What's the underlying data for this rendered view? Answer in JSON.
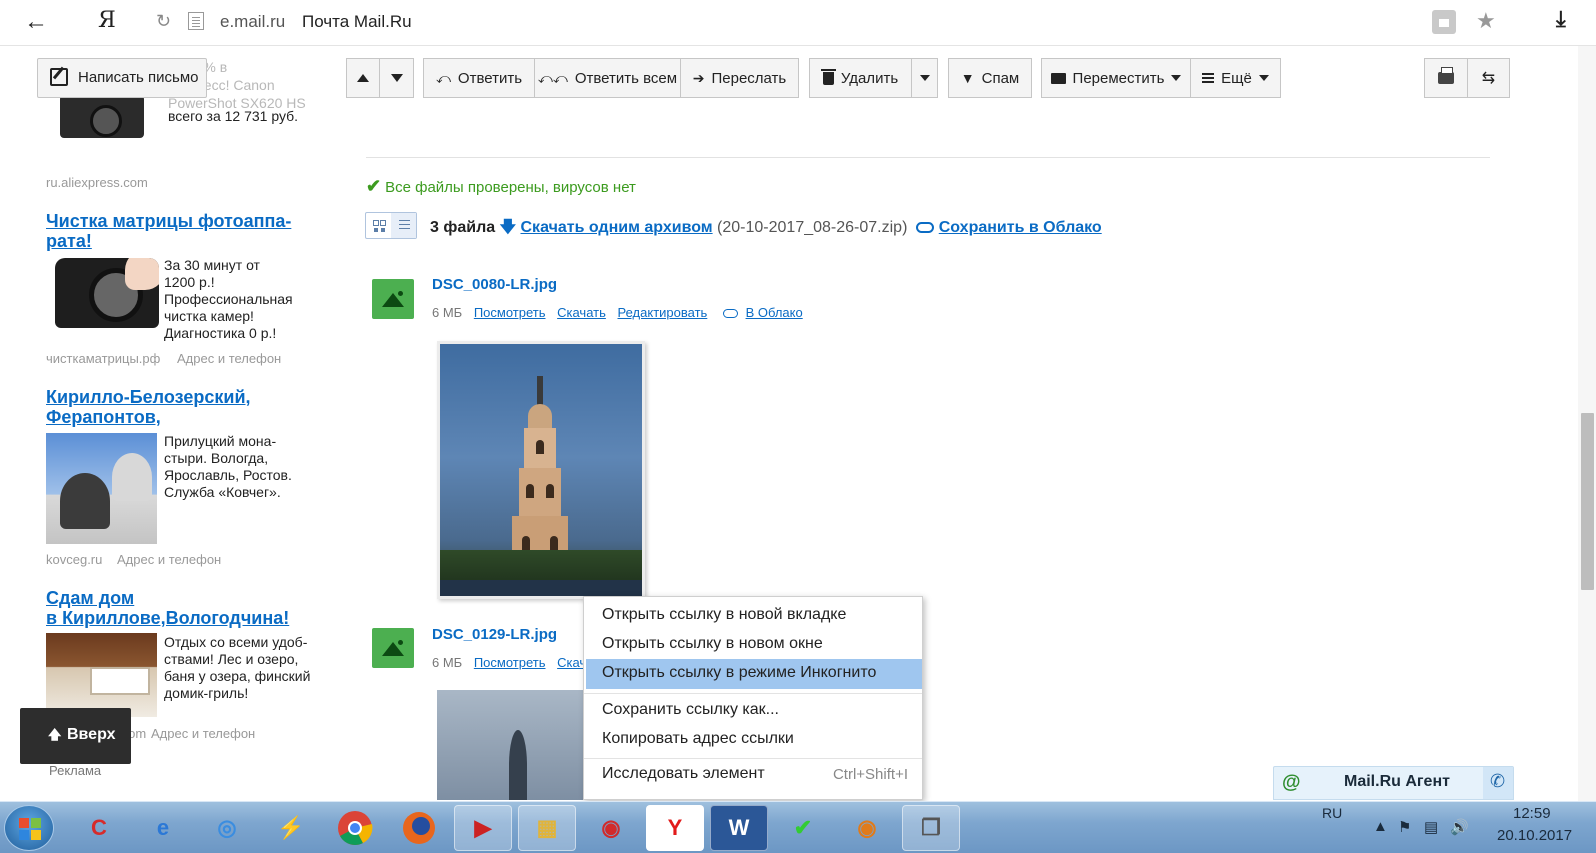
{
  "browser": {
    "domain": "e.mail.ru",
    "title": "Почта Mail.Ru",
    "yandex_glyph": "Я"
  },
  "left": {
    "compose_label": "Написать письмо",
    "ad_top_lines": [
      "до 50% в",
      "экспресс! Canon",
      "PowerShot SX620 HS"
    ],
    "ad_top_price": "всего за 12 731 руб.",
    "ad_top_domain": "ru.aliexpress.com",
    "ads": [
      {
        "title": [
          "Чистка матрицы фотоаппа-",
          "рата!"
        ],
        "desc": [
          "За 30 минут от",
          "1200 р.!",
          "Профессиональная",
          "чистка камер!",
          "Диагностика 0 р.!"
        ],
        "domain": "чисткаматрицы.рф",
        "contact": "Адрес и телефон"
      },
      {
        "title": [
          "Кирилло-Белозерский,",
          "Ферапонтов,"
        ],
        "desc": [
          "Прилуцкий мона-",
          "стыри. Вологда,",
          "Ярославль, Ростов.",
          "Служба «Ковчег»."
        ],
        "domain": "kovceg.ru",
        "contact": "Адрес и телефон"
      },
      {
        "title": [
          "Сдам дом",
          "в Кириллове,Вологодчина!"
        ],
        "desc": [
          "Отдых со всеми удоб-",
          "ствами! Лес и озеро,",
          "баня у озера, финский",
          "домик-гриль!"
        ],
        "domain": ".com",
        "contact": "Адрес и телефон"
      }
    ],
    "ads_label": "Реклама",
    "up_label": "Вверх"
  },
  "toolbar": {
    "reply": "Ответить",
    "reply_all": "Ответить всем",
    "forward": "Переслать",
    "delete": "Удалить",
    "spam": "Спам",
    "move": "Переместить",
    "more": "Ещё"
  },
  "attachments": {
    "virus_status": "Все файлы проверены, вирусов нет",
    "count": "3 файла",
    "download_all": "Скачать одним архивом",
    "archive_name": "(20-10-2017_08-26-07.zip)",
    "save_cloud": "Сохранить в Облако",
    "files": [
      {
        "name": "DSC_0080-LR.jpg",
        "size": "6 МБ",
        "view": "Посмотреть",
        "download": "Скачать",
        "edit": "Редактировать",
        "to_cloud": "В Облако"
      },
      {
        "name": "DSC_0129-LR.jpg",
        "size": "6 МБ",
        "view": "Посмотреть",
        "download": "Скач"
      }
    ]
  },
  "context_menu": {
    "items": [
      "Открыть ссылку в новой вкладке",
      "Открыть ссылку в новом окне",
      "Открыть ссылку в режиме Инкогнито",
      "Сохранить ссылку как...",
      "Копировать адрес ссылки",
      "Исследовать элемент"
    ],
    "inspect_shortcut": "Ctrl+Shift+I",
    "highlighted_index": 2
  },
  "agent": {
    "label": "Mail.Ru Агент",
    "at_glyph": "@"
  },
  "taskbar": {
    "lang": "RU",
    "time": "12:59",
    "date": "20.10.2017",
    "apps": [
      "ccleaner",
      "internet-explorer",
      "safari",
      "winamp",
      "chrome",
      "firefox",
      "movie",
      "explorer",
      "photo",
      "yandex",
      "word",
      "cd-burner",
      "eye-app",
      "window-switcher"
    ]
  },
  "colors": {
    "link": "#0a6bc4",
    "ok_green": "#3c9b1f",
    "menu_highlight": "#9fc6ef",
    "file_icon": "#4caf50"
  }
}
